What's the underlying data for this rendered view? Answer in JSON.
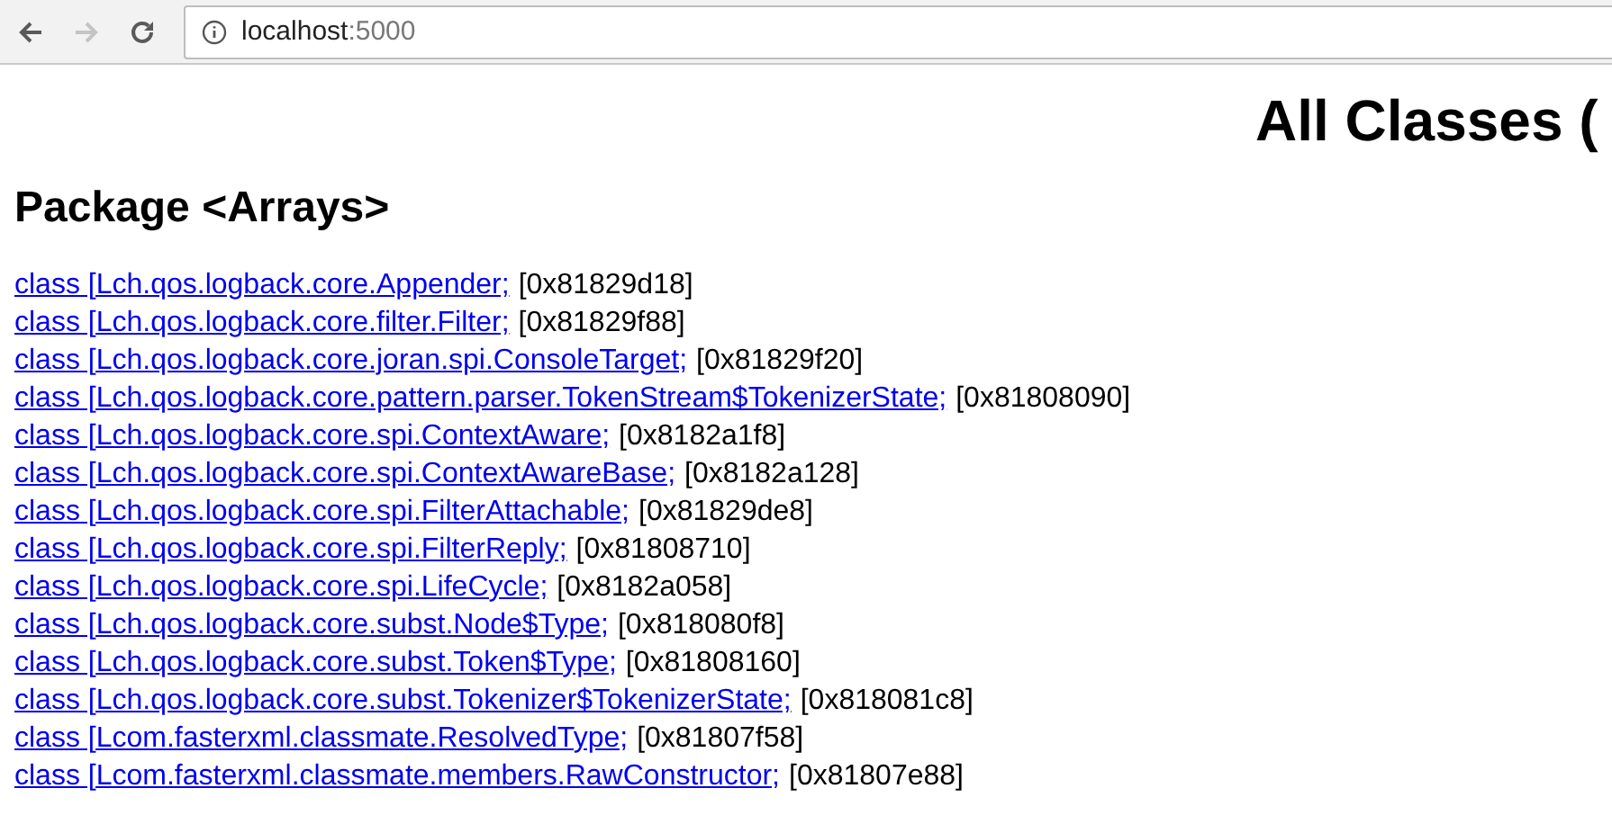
{
  "browser": {
    "back_disabled": false,
    "forward_disabled": true,
    "url_host": "localhost",
    "url_port": ":5000"
  },
  "page_title": "All Classes (",
  "package_heading": "Package <Arrays>",
  "classes": [
    {
      "link": "class [Lch.qos.logback.core.Appender;",
      "address": "[0x81829d18]"
    },
    {
      "link": "class [Lch.qos.logback.core.filter.Filter;",
      "address": "[0x81829f88]"
    },
    {
      "link": "class [Lch.qos.logback.core.joran.spi.ConsoleTarget;",
      "address": "[0x81829f20]"
    },
    {
      "link": "class [Lch.qos.logback.core.pattern.parser.TokenStream$TokenizerState;",
      "address": "[0x81808090]"
    },
    {
      "link": "class [Lch.qos.logback.core.spi.ContextAware;",
      "address": "[0x8182a1f8]"
    },
    {
      "link": "class [Lch.qos.logback.core.spi.ContextAwareBase;",
      "address": "[0x8182a128]"
    },
    {
      "link": "class [Lch.qos.logback.core.spi.FilterAttachable;",
      "address": "[0x81829de8]"
    },
    {
      "link": "class [Lch.qos.logback.core.spi.FilterReply;",
      "address": "[0x81808710]"
    },
    {
      "link": "class [Lch.qos.logback.core.spi.LifeCycle;",
      "address": "[0x8182a058]"
    },
    {
      "link": "class [Lch.qos.logback.core.subst.Node$Type;",
      "address": "[0x818080f8]"
    },
    {
      "link": "class [Lch.qos.logback.core.subst.Token$Type;",
      "address": "[0x81808160]"
    },
    {
      "link": "class [Lch.qos.logback.core.subst.Tokenizer$TokenizerState;",
      "address": "[0x818081c8]"
    },
    {
      "link": "class [Lcom.fasterxml.classmate.ResolvedType;",
      "address": "[0x81807f58]"
    },
    {
      "link": "class [Lcom.fasterxml.classmate.members.RawConstructor;",
      "address": "[0x81807e88]"
    }
  ]
}
